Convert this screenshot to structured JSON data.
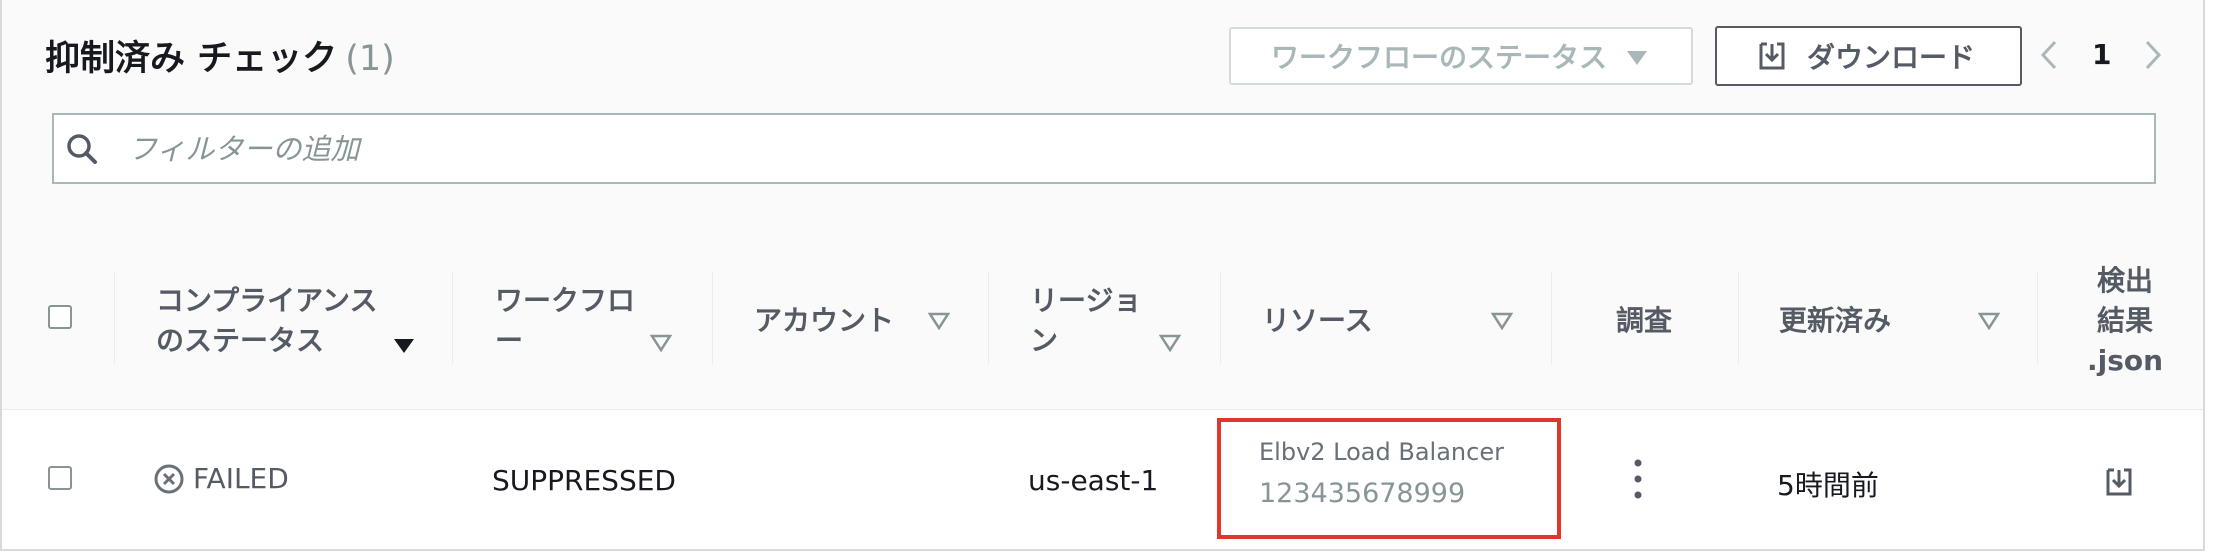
{
  "header": {
    "title": "抑制済み チェック",
    "count": "(1)",
    "status_filter_label": "ワークフローのステータス",
    "download_label": "ダウンロード",
    "page_number": "1"
  },
  "filter": {
    "placeholder": "フィルターの追加"
  },
  "columns": {
    "compliance_line1": "コンプライアンス",
    "compliance_line2": "のステータス",
    "workflow_line1": "ワークフロ",
    "workflow_line2": "ー",
    "account": "アカウント",
    "region_line1": "リージョ",
    "region_line2": "ン",
    "resource": "リソース",
    "investigate": "調査",
    "updated": "更新済み",
    "findings_line1": "検出",
    "findings_line2": "結果",
    "findings_line3": ".json"
  },
  "rows": [
    {
      "compliance_status": "FAILED",
      "workflow": "SUPPRESSED",
      "account": "",
      "region": "us-east-1",
      "resource_type": "Elbv2 Load Balancer",
      "resource_id": "123435678999",
      "updated": "5時間前"
    }
  ],
  "colors": {
    "highlight_border": "#e0362b",
    "header_bg": "#fafafa",
    "text": "#16191f",
    "muted": "#879596"
  }
}
